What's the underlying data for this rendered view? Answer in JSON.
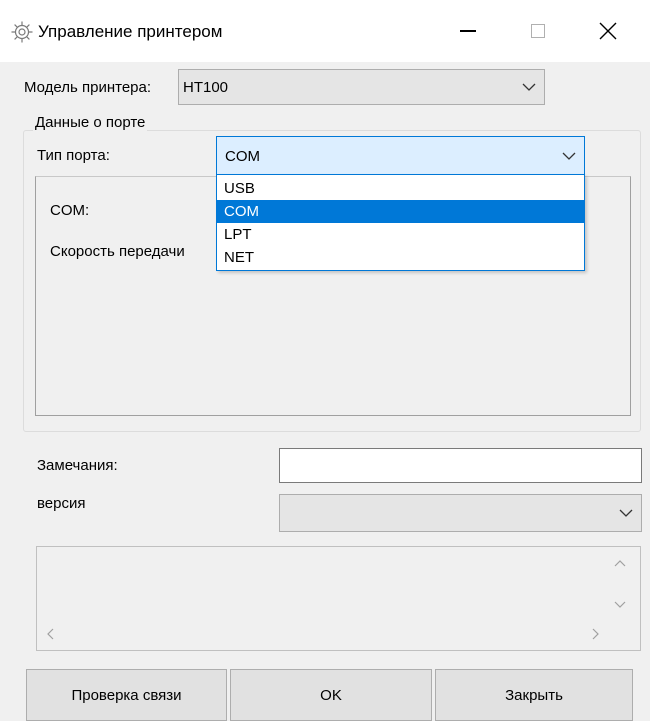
{
  "window": {
    "title": "Управление принтером",
    "icon": "gear-icon"
  },
  "model": {
    "label": "Модель принтера:",
    "value": "HT100"
  },
  "port": {
    "group_label": "Данные о порте",
    "type_label": "Тип порта:",
    "type_value": "COM",
    "options": [
      "USB",
      "COM",
      "LPT",
      "NET"
    ],
    "selected": "COM",
    "com_label": "COM:",
    "speed_label": "Скорость передачи"
  },
  "remarks": {
    "label": "Замечания:",
    "value": ""
  },
  "version": {
    "label": "версия",
    "value": ""
  },
  "buttons": {
    "check": "Проверка связи",
    "ok": "OK",
    "close": "Закрыть"
  },
  "colors": {
    "accent": "#0078d7",
    "window_bg": "#f0f0f0",
    "button_bg": "#e1e1e1"
  }
}
